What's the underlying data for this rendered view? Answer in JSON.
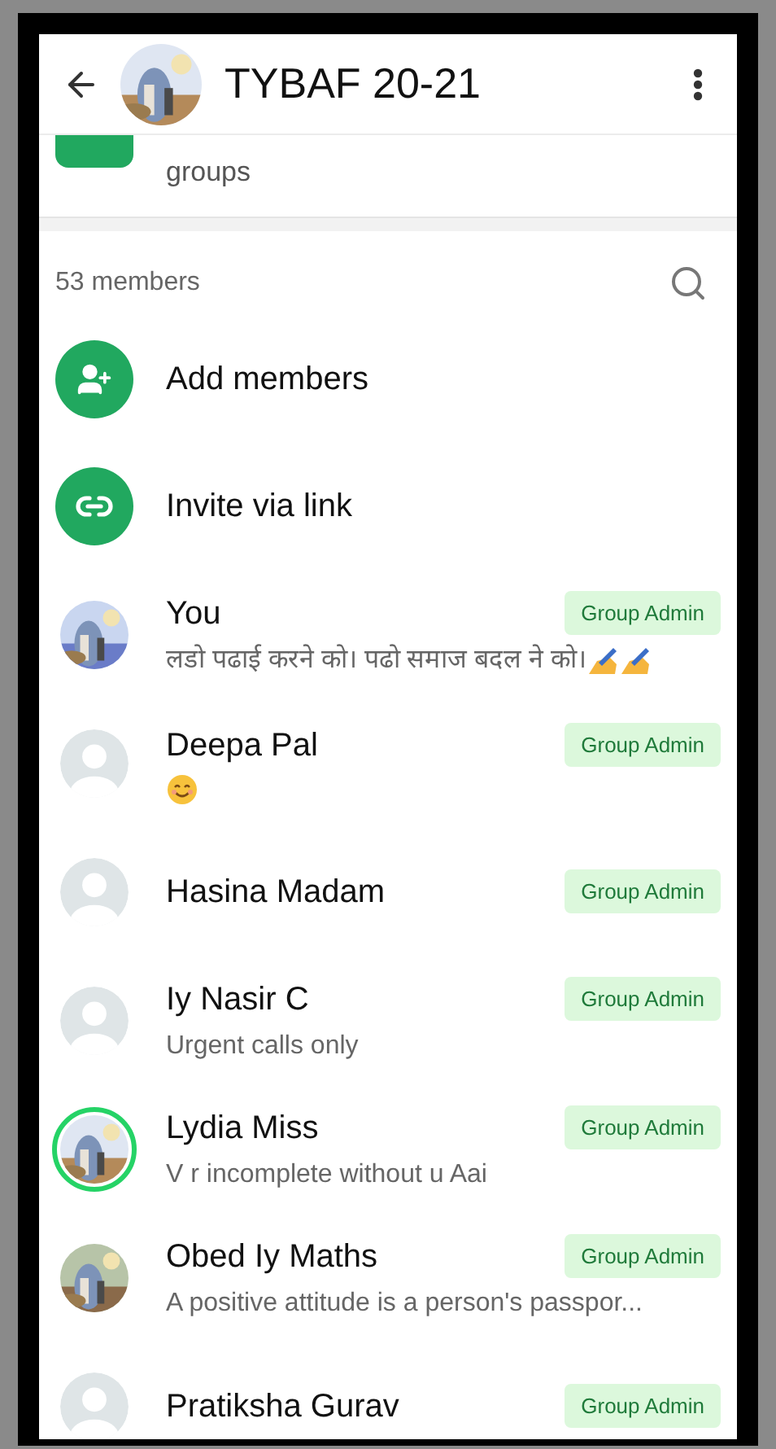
{
  "header": {
    "title": "TYBAF 20-21"
  },
  "community": {
    "description": "groups"
  },
  "members_section": {
    "count": "53 members"
  },
  "actions": [
    {
      "kind": "add",
      "label": "Add members"
    },
    {
      "kind": "link",
      "label": "Invite via link"
    }
  ],
  "members": [
    {
      "name": "You",
      "status": "लडो पढाई करने को। पढो समाज बदल ने को।",
      "status_emoji": {
        "kind": "writing"
      },
      "story": false,
      "badge": "Group Admin"
    },
    {
      "name": "Deepa Pal",
      "status_emoji": {
        "kind": "smile"
      },
      "avatar": {
        "kind": "default"
      },
      "story": false,
      "badge": "Group Admin"
    },
    {
      "name": "Hasina Madam",
      "avatar": {
        "kind": "default"
      },
      "story": false,
      "badge": "Group Admin"
    },
    {
      "name": "Iy Nasir C",
      "status": "Urgent calls only",
      "avatar": {
        "kind": "default"
      },
      "story": false,
      "badge": "Group Admin"
    },
    {
      "name": "Lydia Miss",
      "status": "V r incomplete without u Aai",
      "story": true,
      "badge": "Group Admin"
    },
    {
      "name": "Obed Iy Maths",
      "status": "A positive attitude is a person's passpor...",
      "story": false,
      "badge": "Group Admin"
    },
    {
      "name": "Pratiksha Gurav",
      "avatar": {
        "kind": "default"
      },
      "story": false,
      "badge": "Group Admin"
    }
  ]
}
